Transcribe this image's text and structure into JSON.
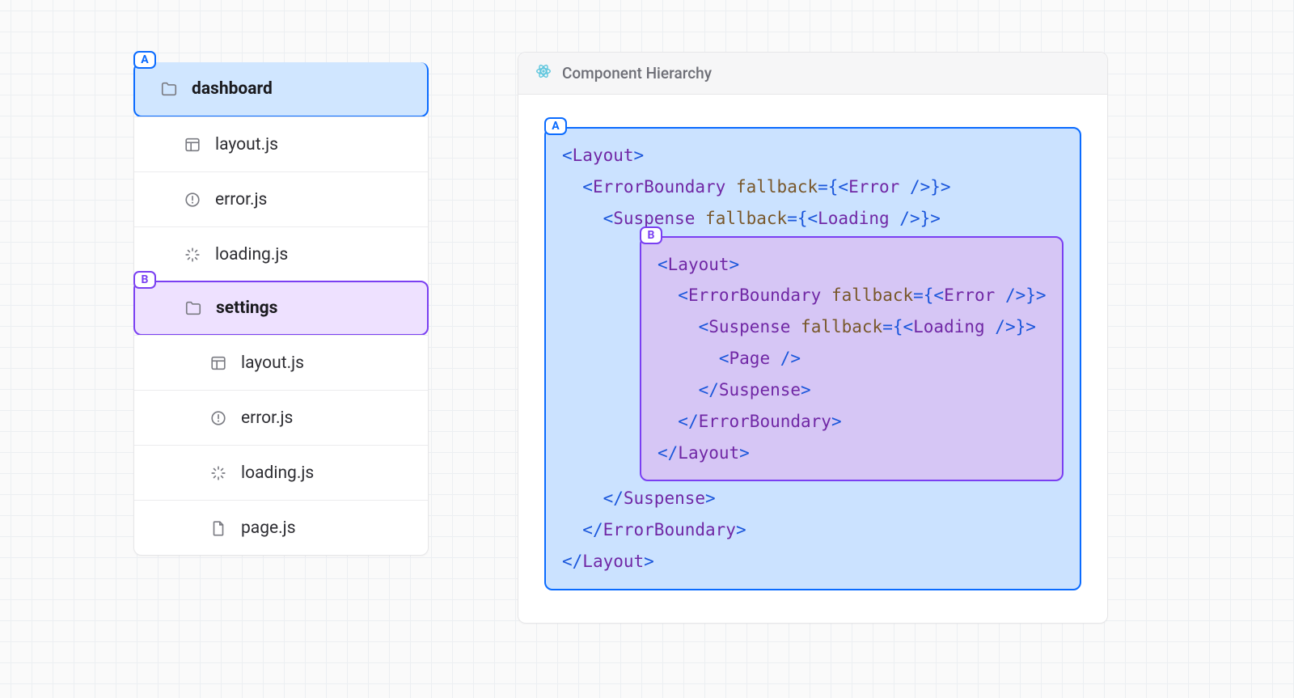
{
  "tree": {
    "badgeA": "A",
    "badgeB": "B",
    "items": [
      {
        "label": "dashboard"
      },
      {
        "label": "layout.js"
      },
      {
        "label": "error.js"
      },
      {
        "label": "loading.js"
      },
      {
        "label": "settings"
      },
      {
        "label": "layout.js"
      },
      {
        "label": "error.js"
      },
      {
        "label": "loading.js"
      },
      {
        "label": "page.js"
      }
    ]
  },
  "hierarchy": {
    "title": "Component Hierarchy",
    "badgeA": "A",
    "badgeB": "B",
    "outer": {
      "line0": {
        "open": "<",
        "tag": "Layout",
        "close": ">"
      },
      "line1": {
        "indent": "  ",
        "open": "<",
        "tag": "ErrorBoundary",
        "sp": " ",
        "attr": "fallback",
        "eqopen": "={<",
        "inner": "Error",
        "selfclose": " />}>"
      },
      "line2": {
        "indent": "    ",
        "open": "<",
        "tag": "Suspense",
        "sp": " ",
        "attr": "fallback",
        "eqopen": "={<",
        "inner": "Loading",
        "selfclose": " />}>"
      },
      "line3": {
        "indent": "    ",
        "open": "</",
        "tag": "Suspense",
        "close": ">"
      },
      "line4": {
        "indent": "  ",
        "open": "</",
        "tag": "ErrorBoundary",
        "close": ">"
      },
      "line5": {
        "open": "</",
        "tag": "Layout",
        "close": ">"
      }
    },
    "inner": {
      "line0": {
        "open": "<",
        "tag": "Layout",
        "close": ">"
      },
      "line1": {
        "indent": "  ",
        "open": "<",
        "tag": "ErrorBoundary",
        "sp": " ",
        "attr": "fallback",
        "eqopen": "={<",
        "inner": "Error",
        "selfclose": " />}>"
      },
      "line2": {
        "indent": "    ",
        "open": "<",
        "tag": "Suspense",
        "sp": " ",
        "attr": "fallback",
        "eqopen": "={<",
        "inner": "Loading",
        "selfclose": " />}>"
      },
      "line3": {
        "indent": "      ",
        "open": "<",
        "tag": "Page",
        "close": " />"
      },
      "line4": {
        "indent": "    ",
        "open": "</",
        "tag": "Suspense",
        "close": ">"
      },
      "line5": {
        "indent": "  ",
        "open": "</",
        "tag": "ErrorBoundary",
        "close": ">"
      },
      "line6": {
        "open": "</",
        "tag": "Layout",
        "close": ">"
      }
    }
  }
}
